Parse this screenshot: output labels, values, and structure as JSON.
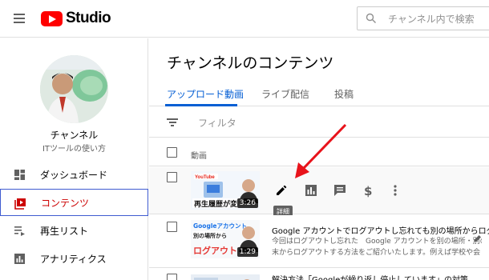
{
  "topbar": {
    "logo_text": "Studio",
    "search_placeholder": "チャンネル内で検索"
  },
  "sidebar": {
    "channel_name": "チャンネル",
    "channel_subtitle": "ITツールの使い方",
    "items": [
      {
        "label": "ダッシュボード",
        "icon": "dashboard-icon",
        "active": false
      },
      {
        "label": "コンテンツ",
        "icon": "content-icon",
        "active": true
      },
      {
        "label": "再生リスト",
        "icon": "playlist-icon",
        "active": false
      },
      {
        "label": "アナリティクス",
        "icon": "analytics-icon",
        "active": false
      }
    ]
  },
  "main": {
    "title": "チャンネルのコンテンツ",
    "tabs": [
      {
        "label": "アップロード動画",
        "active": true
      },
      {
        "label": "ライブ配信",
        "active": false
      },
      {
        "label": "投稿",
        "active": false
      }
    ],
    "filter_label": "フィルタ",
    "column_video": "動画",
    "rows": [
      {
        "thumb_caption_top": "YouTube",
        "thumb_caption": "再生履歴が変",
        "duration": "3:26",
        "hover": true,
        "tooltip": "詳細",
        "actions": [
          "edit-icon",
          "analytics-icon",
          "comments-icon",
          "monetization-icon",
          "more-icon"
        ]
      },
      {
        "thumb_caption_top": "Googleアカウント",
        "thumb_caption_mid": "別の場所から",
        "thumb_caption": "ログアウト",
        "duration": "1:29",
        "title": "Google アカウントでログアウトし忘れても別の場所からログア",
        "desc1": "今回はログアウトし忘れた　Google アカウントを別の場所・別の端",
        "desc2": "末からログアウトする方法をご紹介いたします。例えば学校や会"
      },
      {
        "title": "解決方法「Googleが繰り返し停止しています」の対策"
      }
    ]
  },
  "colors": {
    "accent": "#065fd4",
    "brand": "#ff0000",
    "active_nav_text": "#cc0000",
    "annotation_arrow": "#e8131b"
  }
}
